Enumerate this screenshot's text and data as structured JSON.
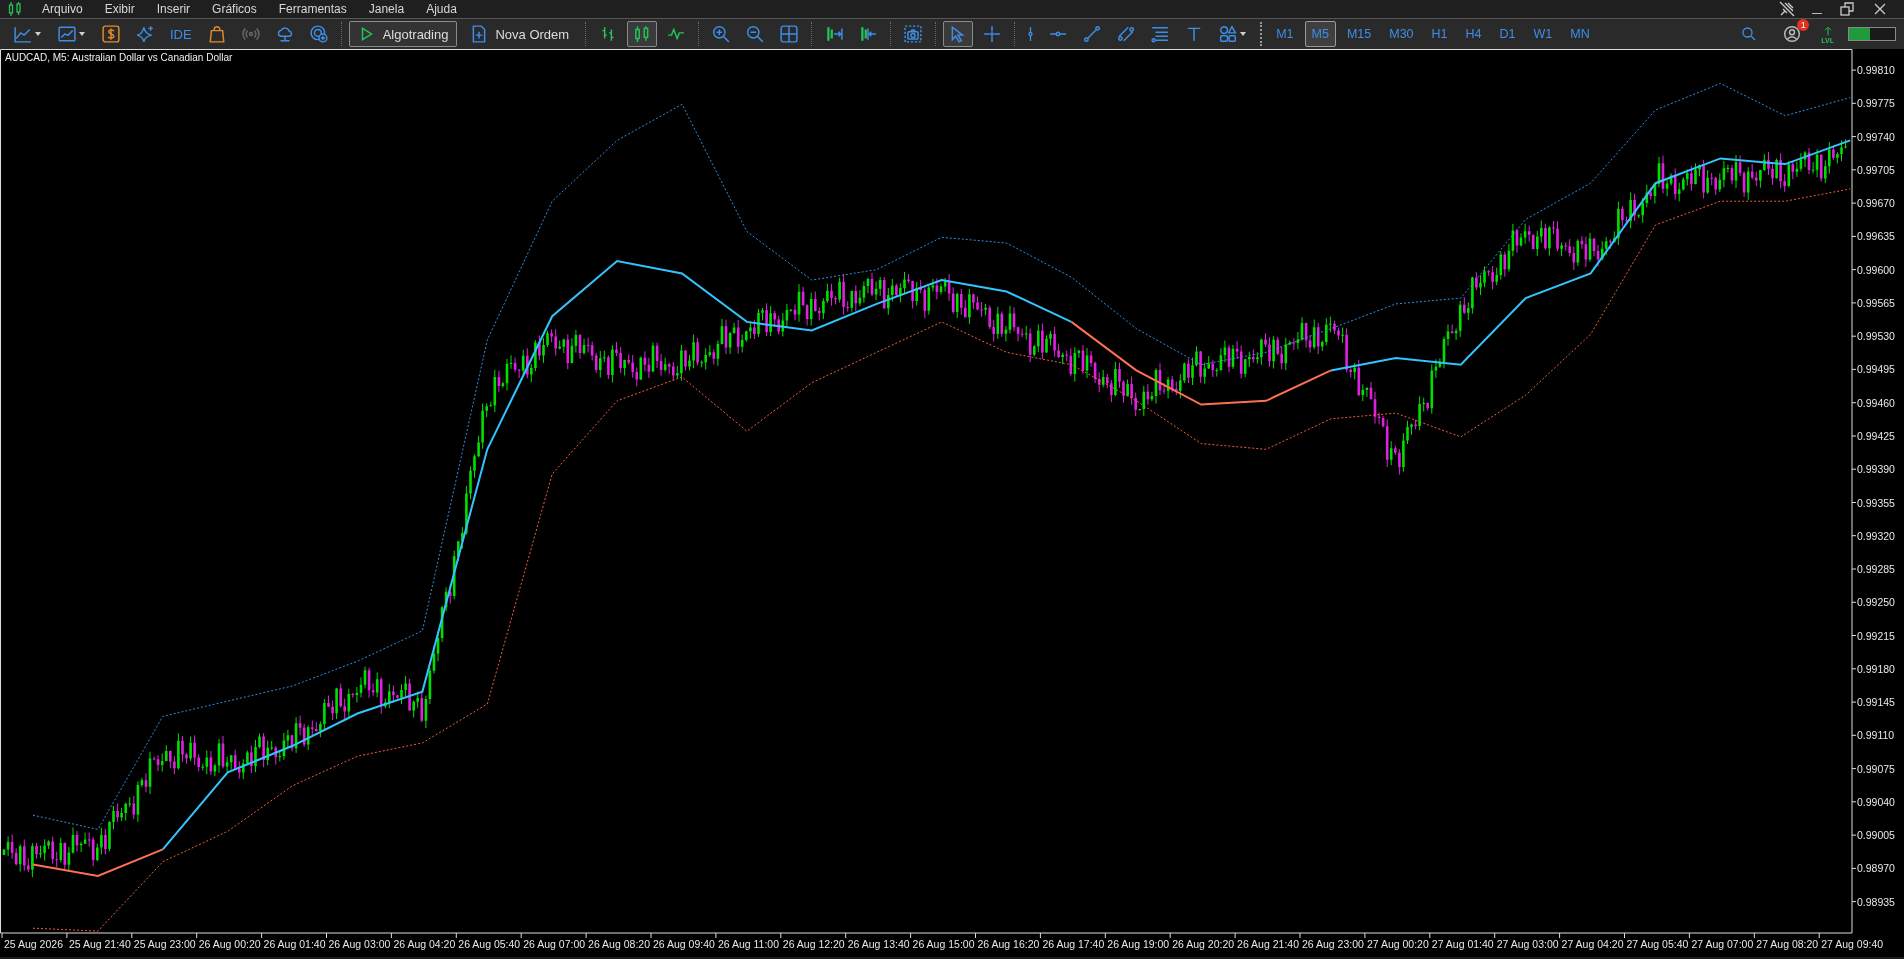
{
  "menu": {
    "items": [
      "Arquivo",
      "Exibir",
      "Inserir",
      "Gráficos",
      "Ferramentas",
      "Janela",
      "Ajuda"
    ]
  },
  "toolbar": {
    "items": [
      {
        "kind": "dropdown",
        "selected": false
      },
      {
        "kind": "dropdown",
        "selected": false
      },
      {
        "kind": "icon",
        "selected": false
      },
      {
        "kind": "icon",
        "selected": false
      },
      {
        "kind": "text",
        "label": "IDE",
        "selected": false
      },
      {
        "kind": "icon",
        "selected": false
      },
      {
        "kind": "icon",
        "selected": false
      },
      {
        "kind": "icon",
        "selected": false
      },
      {
        "kind": "icon",
        "selected": false
      },
      {
        "kind": "separator"
      },
      {
        "kind": "toggle",
        "label": "Algotrading",
        "on": true
      },
      {
        "kind": "button",
        "label": "Nova Ordem",
        "selected": false
      },
      {
        "kind": "separator"
      },
      {
        "kind": "icon",
        "selected": false
      },
      {
        "kind": "icon",
        "selected": true
      },
      {
        "kind": "icon",
        "selected": false
      },
      {
        "kind": "separator"
      },
      {
        "kind": "icon",
        "selected": false
      },
      {
        "kind": "icon",
        "selected": false
      },
      {
        "kind": "icon",
        "selected": false
      },
      {
        "kind": "separator"
      },
      {
        "kind": "icon",
        "selected": false
      },
      {
        "kind": "icon",
        "selected": false
      },
      {
        "kind": "separator"
      },
      {
        "kind": "icon",
        "selected": false
      },
      {
        "kind": "separator"
      },
      {
        "kind": "icon",
        "selected": true
      },
      {
        "kind": "icon",
        "selected": false
      },
      {
        "kind": "separator"
      },
      {
        "kind": "icon",
        "selected": false
      },
      {
        "kind": "icon",
        "selected": false
      },
      {
        "kind": "icon",
        "selected": false
      },
      {
        "kind": "icon",
        "selected": false
      },
      {
        "kind": "icon",
        "selected": false
      },
      {
        "kind": "icon",
        "selected": false
      },
      {
        "kind": "dropdown",
        "selected": false
      }
    ]
  },
  "timeframes": [
    {
      "label": "M1",
      "selected": false
    },
    {
      "label": "M5",
      "selected": true
    },
    {
      "label": "M15",
      "selected": false
    },
    {
      "label": "M30",
      "selected": false
    },
    {
      "label": "H1",
      "selected": false
    },
    {
      "label": "H4",
      "selected": false
    },
    {
      "label": "D1",
      "selected": false
    },
    {
      "label": "W1",
      "selected": false
    },
    {
      "label": "MN",
      "selected": false
    }
  ],
  "status": {
    "notification_badge": "1",
    "signal_label": "LVL",
    "meter": {
      "level": 0.45
    }
  },
  "chart": {
    "title": "AUDCAD, M5:  Australian Dollar vs Canadian Dollar",
    "chart_data": {
      "type": "line",
      "categories": [
        "25 Aug 2026",
        "25 Aug 21:40",
        "25 Aug 23:00",
        "26 Aug 00:20",
        "26 Aug 01:40",
        "26 Aug 03:00",
        "26 Aug 04:20",
        "26 Aug 05:40",
        "26 Aug 07:00",
        "26 Aug 08:20",
        "26 Aug 09:40",
        "26 Aug 11:00",
        "26 Aug 12:20",
        "26 Aug 13:40",
        "26 Aug 15:00",
        "26 Aug 16:20",
        "26 Aug 17:40",
        "26 Aug 19:00",
        "26 Aug 20:20",
        "26 Aug 21:40",
        "26 Aug 23:00",
        "27 Aug 00:20",
        "27 Aug 01:40",
        "27 Aug 03:00",
        "27 Aug 04:20",
        "27 Aug 05:40",
        "27 Aug 07:00",
        "27 Aug 08:20",
        "27 Aug 09:40"
      ],
      "ylim": [
        0.98902,
        0.99829
      ],
      "yticks": [
        {
          "value": 0.9981,
          "label": "0.99810"
        },
        {
          "value": 0.99775,
          "label": "0.99775"
        },
        {
          "value": 0.9974,
          "label": "0.99740"
        },
        {
          "value": 0.99705,
          "label": "0.99705"
        },
        {
          "value": 0.9967,
          "label": "0.99670"
        },
        {
          "value": 0.99635,
          "label": "0.99635"
        },
        {
          "value": 0.996,
          "label": "0.99600"
        },
        {
          "value": 0.99565,
          "label": "0.99565"
        },
        {
          "value": 0.9953,
          "label": "0.99530"
        },
        {
          "value": 0.99495,
          "label": "0.99495"
        },
        {
          "value": 0.9946,
          "label": "0.99460"
        },
        {
          "value": 0.99425,
          "label": "0.99425"
        },
        {
          "value": 0.9939,
          "label": "0.99390"
        },
        {
          "value": 0.99355,
          "label": "0.99355"
        },
        {
          "value": 0.9932,
          "label": "0.99320"
        },
        {
          "value": 0.99285,
          "label": "0.99285"
        },
        {
          "value": 0.9925,
          "label": "0.99250"
        },
        {
          "value": 0.99215,
          "label": "0.99215"
        },
        {
          "value": 0.9918,
          "label": "0.99180"
        },
        {
          "value": 0.99145,
          "label": "0.99145"
        },
        {
          "value": 0.9911,
          "label": "0.99110"
        },
        {
          "value": 0.99075,
          "label": "0.99075"
        },
        {
          "value": 0.9904,
          "label": "0.99040"
        },
        {
          "value": 0.99005,
          "label": "0.99005"
        },
        {
          "value": 0.9897,
          "label": "0.98970"
        },
        {
          "value": 0.98935,
          "label": "0.98935"
        }
      ],
      "series": [
        {
          "line_style": "dashed",
          "color": "#2d8fe8",
          "values": [
            0.99026,
            0.99011,
            0.9913,
            0.99146,
            0.99162,
            0.99188,
            0.9922,
            0.99526,
            0.99672,
            0.99736,
            0.99774,
            0.9964,
            0.99589,
            0.996,
            0.99634,
            0.99628,
            0.99592,
            0.99538,
            0.995,
            0.99513,
            0.99538,
            0.99564,
            0.9957,
            0.99653,
            0.99691,
            0.99768,
            0.99796,
            0.99762,
            0.99781
          ]
        },
        {
          "line_style": "dashed",
          "color": "#f0603a",
          "values": [
            0.98907,
            0.98904,
            0.98977,
            0.99009,
            0.99057,
            0.99088,
            0.99102,
            0.99143,
            0.99385,
            0.99462,
            0.99487,
            0.9943,
            0.99481,
            0.99513,
            0.99545,
            0.99513,
            0.995,
            0.99462,
            0.99417,
            0.99411,
            0.99443,
            0.99449,
            0.99424,
            0.99468,
            0.99532,
            0.99647,
            0.99672,
            0.99672,
            0.99685
          ]
        },
        {
          "line_style": "solid",
          "color": "#33c4ff",
          "values": [
            null,
            null,
            0.9899,
            0.99071,
            0.99099,
            0.99133,
            0.99156,
            0.99411,
            0.99551,
            0.99609,
            0.99596,
            0.99545,
            0.99536,
            0.99564,
            0.99589,
            0.99577,
            0.99545,
            null,
            null,
            null,
            0.99494,
            0.99507,
            0.995,
            0.9957,
            0.99596,
            0.99691,
            0.99717,
            0.99711,
            0.99736
          ]
        },
        {
          "line_style": "solid",
          "color": "#ff7050",
          "values": [
            0.98974,
            0.98962,
            0.9899,
            null,
            null,
            null,
            null,
            null,
            null,
            null,
            null,
            null,
            null,
            null,
            null,
            null,
            0.99545,
            0.99494,
            0.99458,
            0.99462,
            0.99494,
            null,
            null,
            null,
            null,
            null,
            null,
            null,
            null
          ]
        }
      ]
    }
  }
}
